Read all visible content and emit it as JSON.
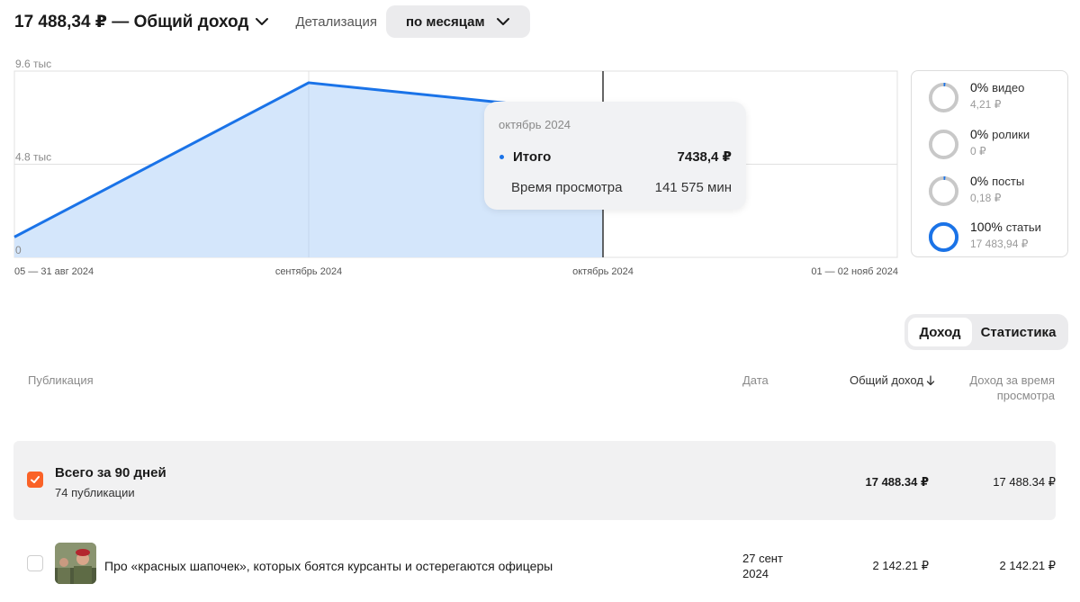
{
  "header": {
    "total_label": "17 488,34 ₽ — Общий доход",
    "detail_label": "Детализация",
    "period_button": "по месяцам"
  },
  "chart": {
    "y_ticks": [
      "9.6 тыс",
      "4.8 тыс",
      "0"
    ],
    "x_ticks": [
      "05 — 31 авг 2024",
      "сентябрь 2024",
      "октябрь 2024",
      "01 — 02 нояб 2024"
    ]
  },
  "chart_data": {
    "type": "area",
    "categories": [
      "05 — 31 авг 2024",
      "сентябрь 2024",
      "октябрь 2024",
      "01 — 02 нояб 2024"
    ],
    "series": [
      {
        "values": [
          1050,
          9000,
          7438.4,
          null
        ]
      }
    ],
    "ylim": [
      0,
      9600
    ],
    "grid": true,
    "colors": {
      "line": "#1a73e8",
      "fill": "#d4e6fb"
    }
  },
  "tooltip": {
    "month": "октябрь 2024",
    "total_label": "Итого",
    "total_value": "7438,4 ₽",
    "watch_label": "Время просмотра",
    "watch_value": "141 575 мин"
  },
  "legend": [
    {
      "pct": "0%",
      "name": "видео",
      "amount": "4,21 ₽",
      "share": 0.02
    },
    {
      "pct": "0%",
      "name": "ролики",
      "amount": "0 ₽",
      "share": 0
    },
    {
      "pct": "0%",
      "name": "посты",
      "amount": "0,18 ₽",
      "share": 0.02
    },
    {
      "pct": "100%",
      "name": "статьи",
      "amount": "17 483,94 ₽",
      "share": 1
    }
  ],
  "tabs": {
    "income": "Доход",
    "stats": "Статистика"
  },
  "table": {
    "col_publication": "Публикация",
    "col_date": "Дата",
    "col_total_income": "Общий доход",
    "col_watch_income_line1": "Доход за время",
    "col_watch_income_line2": "просмотра",
    "summary": {
      "title": "Всего за 90 дней",
      "subtitle": "74 публикации",
      "total_income": "17 488.34 ₽",
      "watch_income": "17 488.34 ₽"
    },
    "rows": [
      {
        "title": "Про «красных шапочек», которых боятся курсанты и остерегаются офицеры",
        "date_line1": "27 сент",
        "date_line2": "2024",
        "total_income": "2 142.21 ₽",
        "watch_income": "2 142.21 ₽"
      }
    ]
  },
  "colors": {
    "accent_blue": "#1a73e8",
    "accent_orange": "#fa6227"
  }
}
